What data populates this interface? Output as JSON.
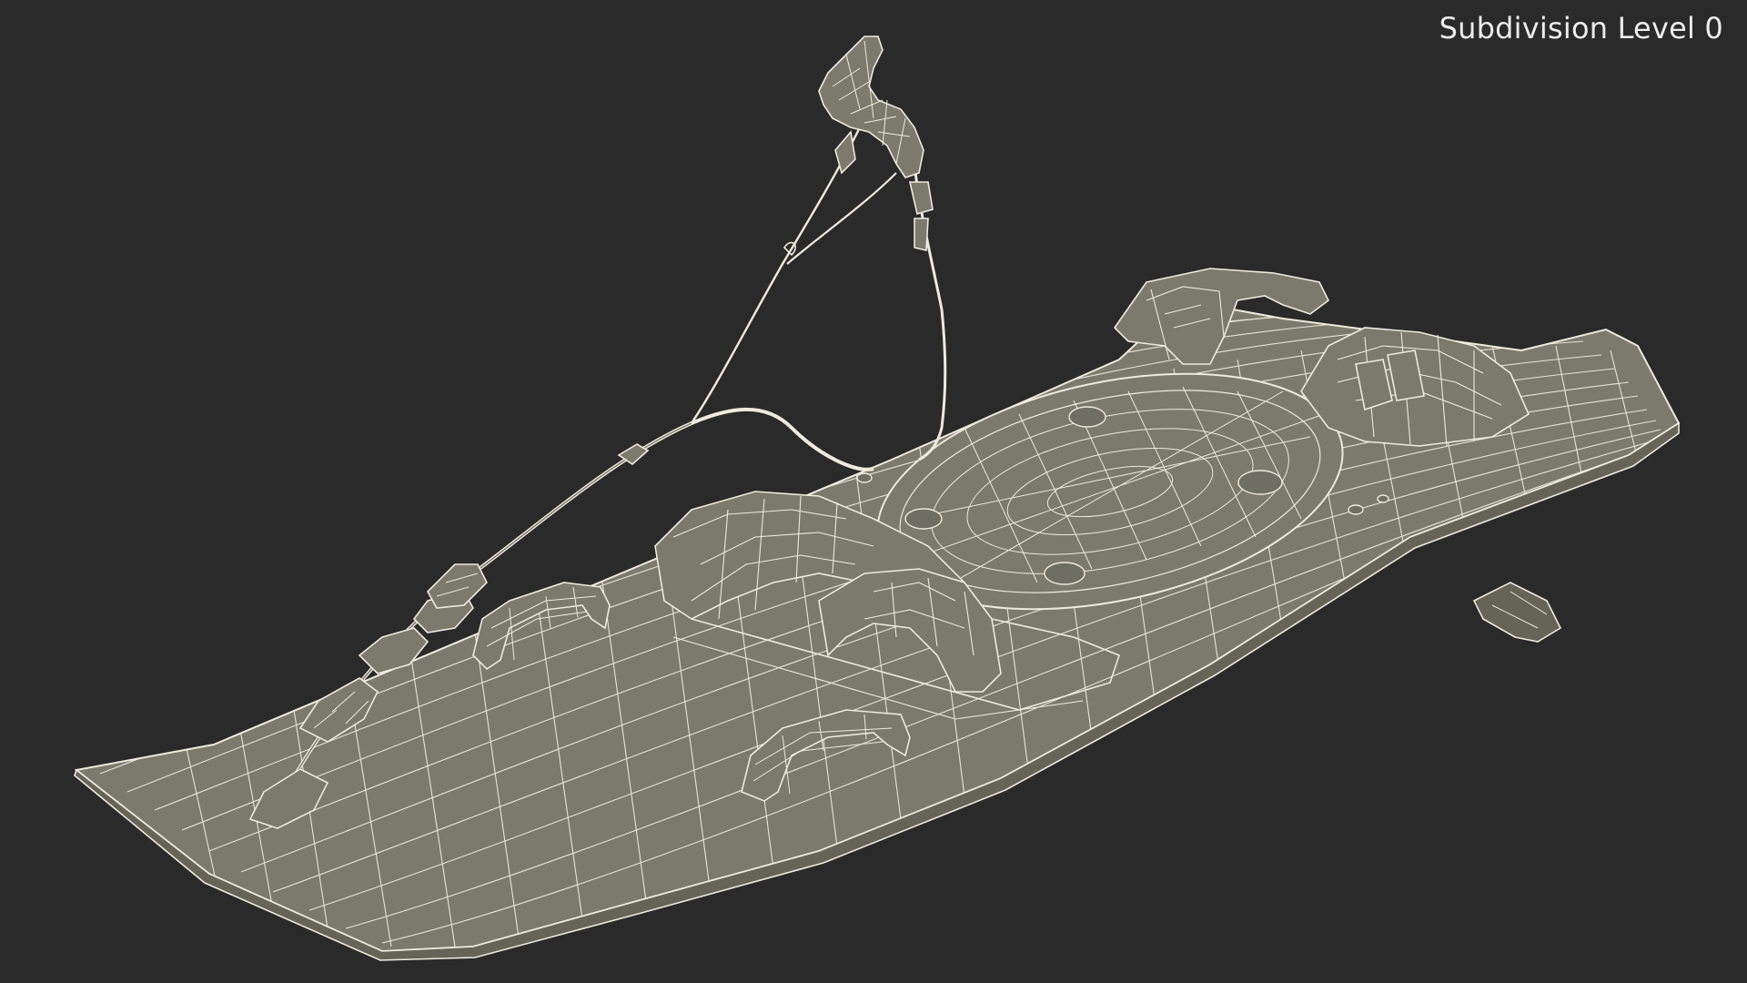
{
  "viewport": {
    "label": "Subdivision Level 0"
  },
  "colors": {
    "background": "#2a2a2a",
    "surface": "#7b7a6d",
    "surface_dark": "#656457",
    "wire": "#eeeadc",
    "label": "#ececec"
  },
  "model": {
    "name": "wakeboard-with-rope-wireframe",
    "parts": [
      "board",
      "front-binding",
      "rear-binding",
      "handle-left",
      "handle-right",
      "tow-rope",
      "rope-handle",
      "fin"
    ]
  }
}
